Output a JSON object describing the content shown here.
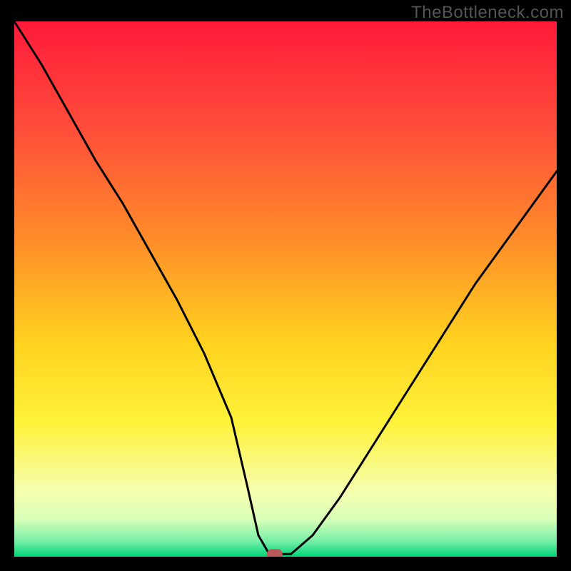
{
  "watermark": "TheBottleneck.com",
  "chart_data": {
    "type": "line",
    "title": "",
    "xlabel": "",
    "ylabel": "",
    "xlim": [
      0,
      100
    ],
    "ylim": [
      0,
      100
    ],
    "x": [
      0,
      5,
      10,
      15,
      20,
      25,
      30,
      35,
      40,
      43,
      45,
      47,
      49,
      51,
      55,
      60,
      65,
      70,
      75,
      80,
      85,
      90,
      95,
      100
    ],
    "y": [
      100,
      92,
      83,
      74,
      66,
      57,
      48,
      38,
      26,
      13,
      4,
      0.5,
      0.5,
      0.5,
      4,
      11,
      19,
      27,
      35,
      43,
      51,
      58,
      65,
      72
    ],
    "optimum_x": 48,
    "flat_range": [
      46,
      50
    ],
    "marker": {
      "x": 48,
      "y": 0.5,
      "color": "#b85a5a"
    },
    "background": {
      "type": "vertical-gradient",
      "stops": [
        {
          "pos": 0.0,
          "color": "#ff1a3a"
        },
        {
          "pos": 0.2,
          "color": "#ff4d3a"
        },
        {
          "pos": 0.4,
          "color": "#ff8a2a"
        },
        {
          "pos": 0.6,
          "color": "#ffd21f"
        },
        {
          "pos": 0.75,
          "color": "#fff23a"
        },
        {
          "pos": 0.88,
          "color": "#f5ffb0"
        },
        {
          "pos": 0.93,
          "color": "#d8ffb8"
        },
        {
          "pos": 0.97,
          "color": "#7af0a8"
        },
        {
          "pos": 1.0,
          "color": "#00d478"
        }
      ]
    }
  }
}
